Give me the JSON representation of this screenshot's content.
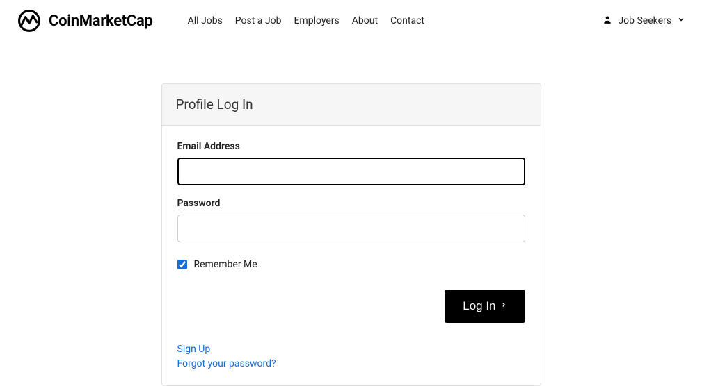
{
  "header": {
    "brand": "CoinMarketCap",
    "nav": {
      "all_jobs": "All Jobs",
      "post_a_job": "Post a Job",
      "employers": "Employers",
      "about": "About",
      "contact": "Contact"
    },
    "user_menu_label": "Job Seekers"
  },
  "login": {
    "title": "Profile Log In",
    "email_label": "Email Address",
    "email_value": "",
    "password_label": "Password",
    "password_value": "",
    "remember_label": "Remember Me",
    "remember_checked": true,
    "login_button": "Log In",
    "signup_link": "Sign Up",
    "forgot_link": "Forgot your password?"
  }
}
